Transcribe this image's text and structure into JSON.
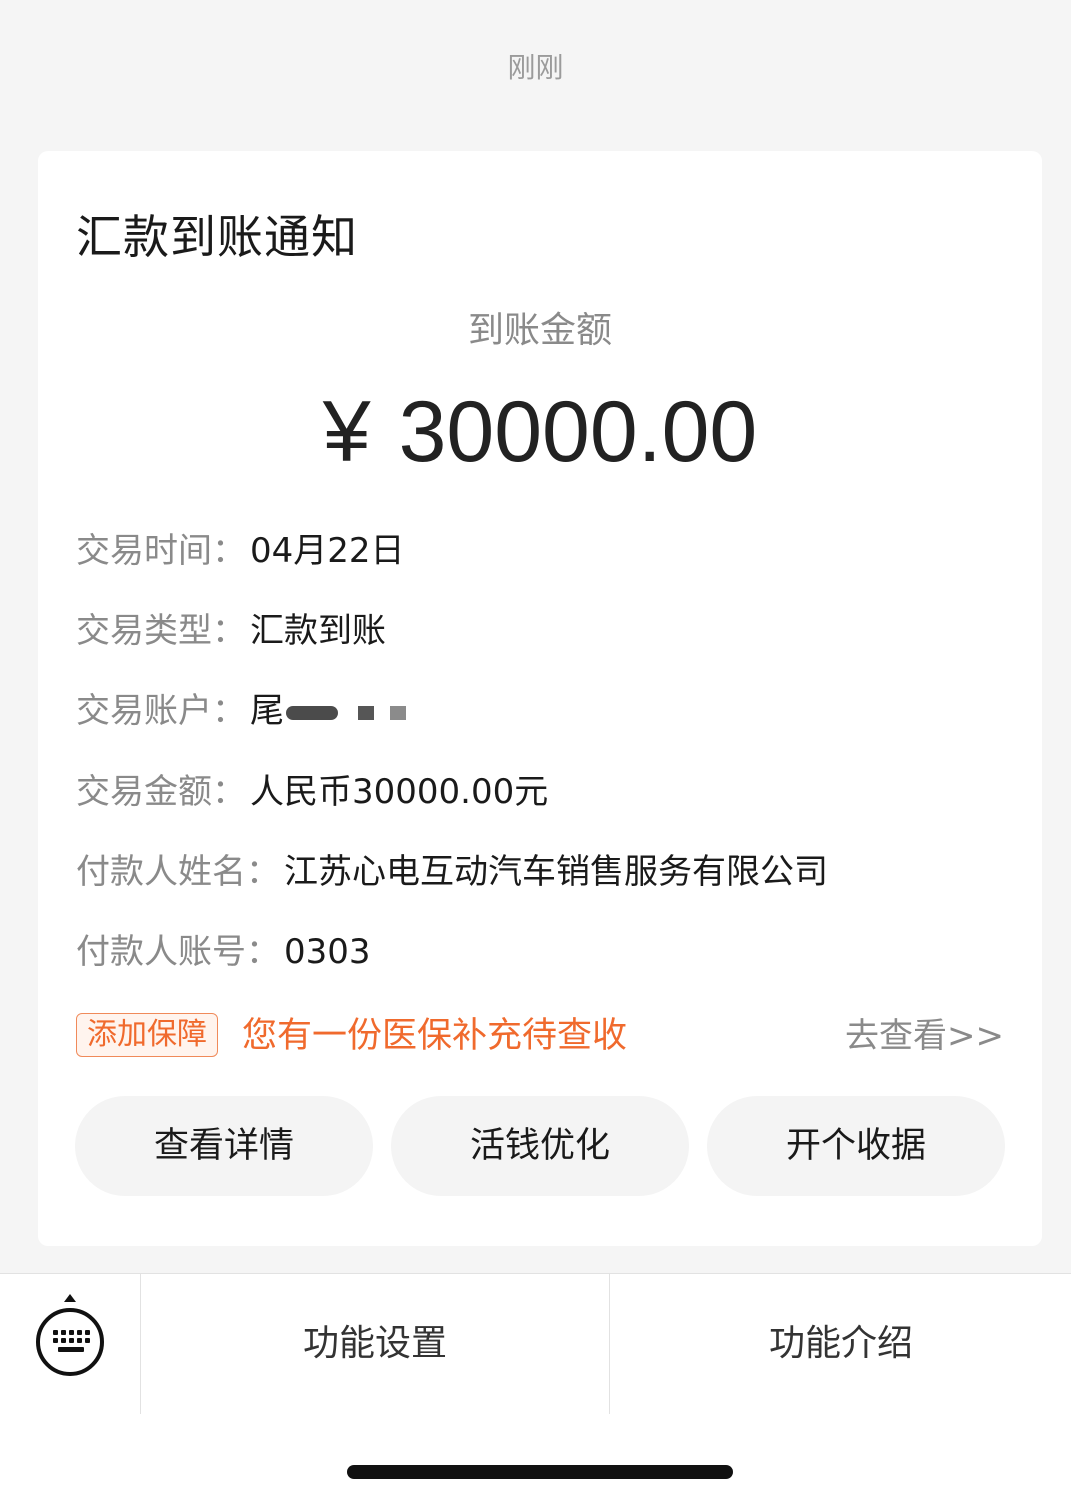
{
  "timestamp": "刚刚",
  "card": {
    "title": "汇款到账通知",
    "amount_label": "到账金额",
    "amount_currency": "¥",
    "amount_value": "30000.00",
    "details": {
      "time": {
        "key": "交易时间：",
        "value": "04月22日"
      },
      "type": {
        "key": "交易类型：",
        "value": "汇款到账"
      },
      "account": {
        "key": "交易账户：",
        "value": "尾"
      },
      "amount": {
        "key": "交易金额：",
        "value": "人民币30000.00元"
      },
      "payer_name": {
        "key": "付款人姓名：",
        "value": "江苏心电互动汽车销售服务有限公司"
      },
      "payer_account": {
        "key": "付款人账号：",
        "value": "0303"
      }
    },
    "promo": {
      "tag": "添加保障",
      "text": "您有一份医保补充待查收",
      "link": "去查看>>"
    },
    "buttons": {
      "details": "查看详情",
      "optimize": "活钱优化",
      "receipt": "开个收据"
    }
  },
  "bottom_menu": {
    "settings": "功能设置",
    "intro": "功能介绍"
  },
  "icons": {
    "keyboard": "keyboard-icon"
  },
  "colors": {
    "accent": "#f06a2d",
    "background": "#f5f5f5"
  }
}
